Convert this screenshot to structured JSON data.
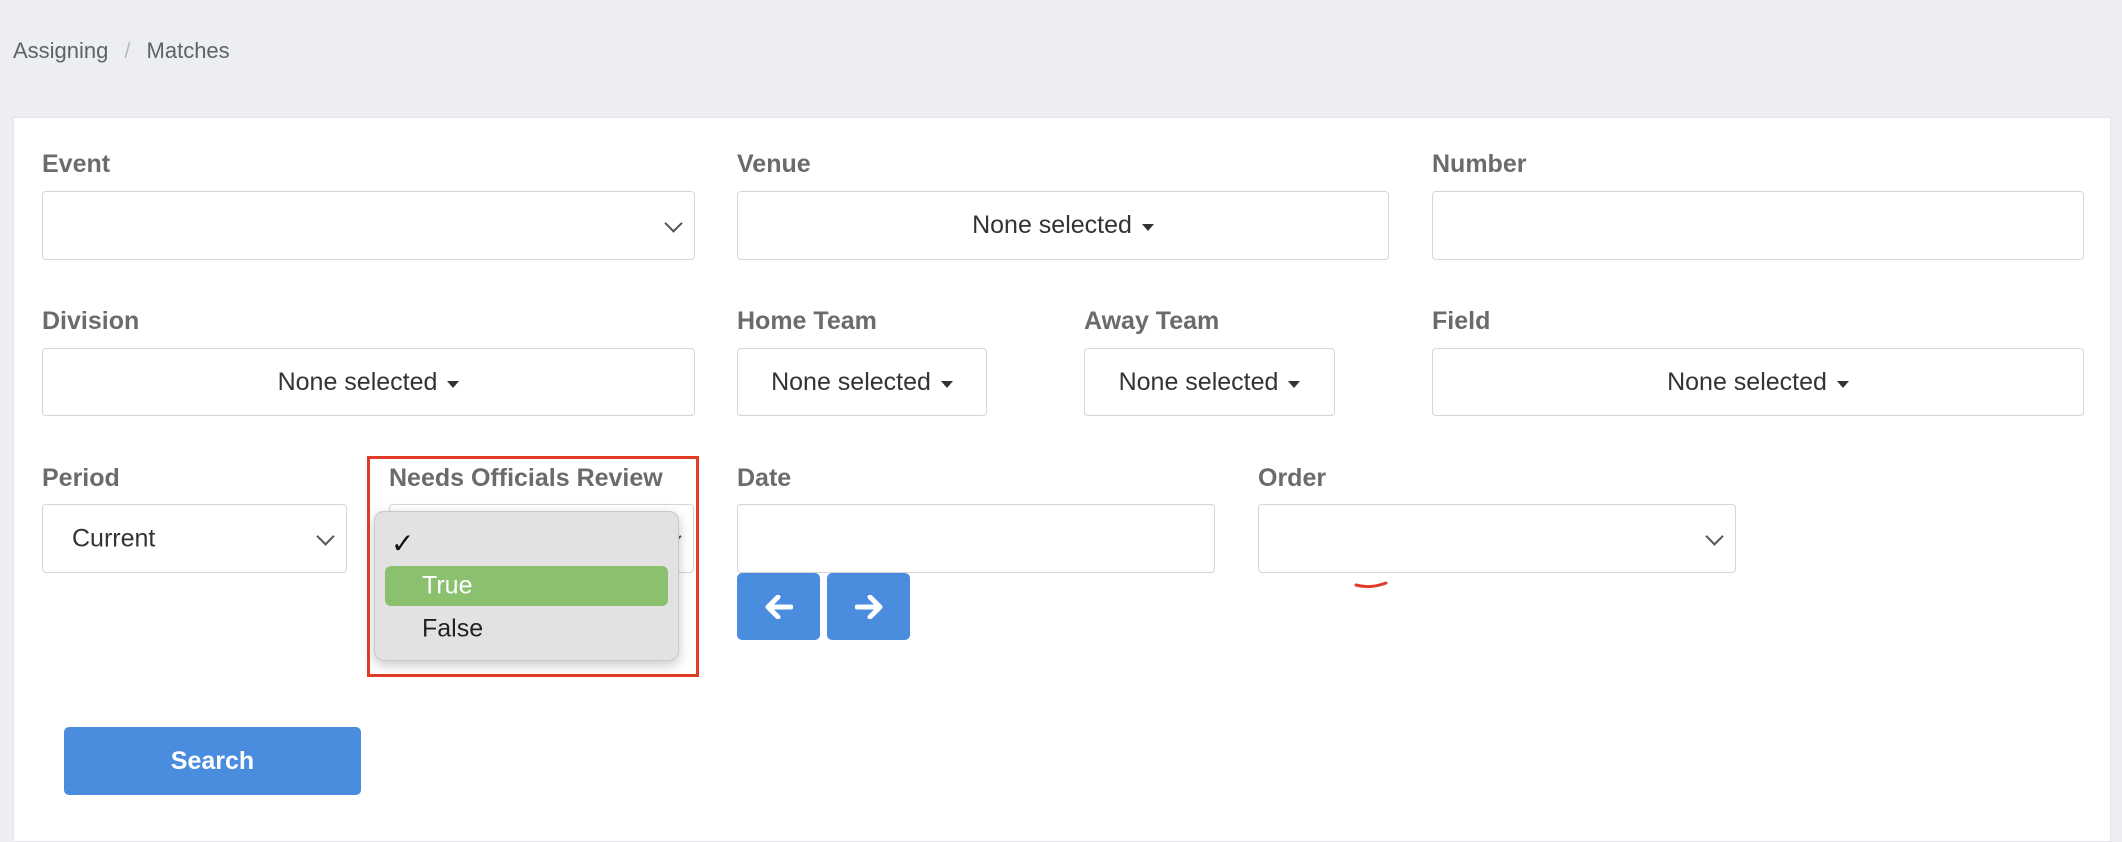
{
  "breadcrumb": {
    "items": [
      "Assigning",
      "Matches"
    ],
    "separator": "/"
  },
  "filters": {
    "event": {
      "label": "Event",
      "value": ""
    },
    "venue": {
      "label": "Venue",
      "value": "None selected"
    },
    "number": {
      "label": "Number",
      "value": ""
    },
    "division": {
      "label": "Division",
      "value": "None selected"
    },
    "home_team": {
      "label": "Home Team",
      "value": "None selected"
    },
    "away_team": {
      "label": "Away Team",
      "value": "None selected"
    },
    "field": {
      "label": "Field",
      "value": "None selected"
    },
    "period": {
      "label": "Period",
      "value": "Current"
    },
    "needs_review": {
      "label": "Needs Officials Review",
      "options": [
        {
          "label": "",
          "checked": true
        },
        {
          "label": "True",
          "highlighted": true
        },
        {
          "label": "False"
        }
      ]
    },
    "date": {
      "label": "Date",
      "value": ""
    },
    "order": {
      "label": "Order",
      "value": ""
    }
  },
  "search_button": {
    "label": "Search"
  },
  "colors": {
    "primary_button": "#4a8ddf",
    "highlight_option": "#8bc16e",
    "annotation_box": "#e03b24"
  }
}
